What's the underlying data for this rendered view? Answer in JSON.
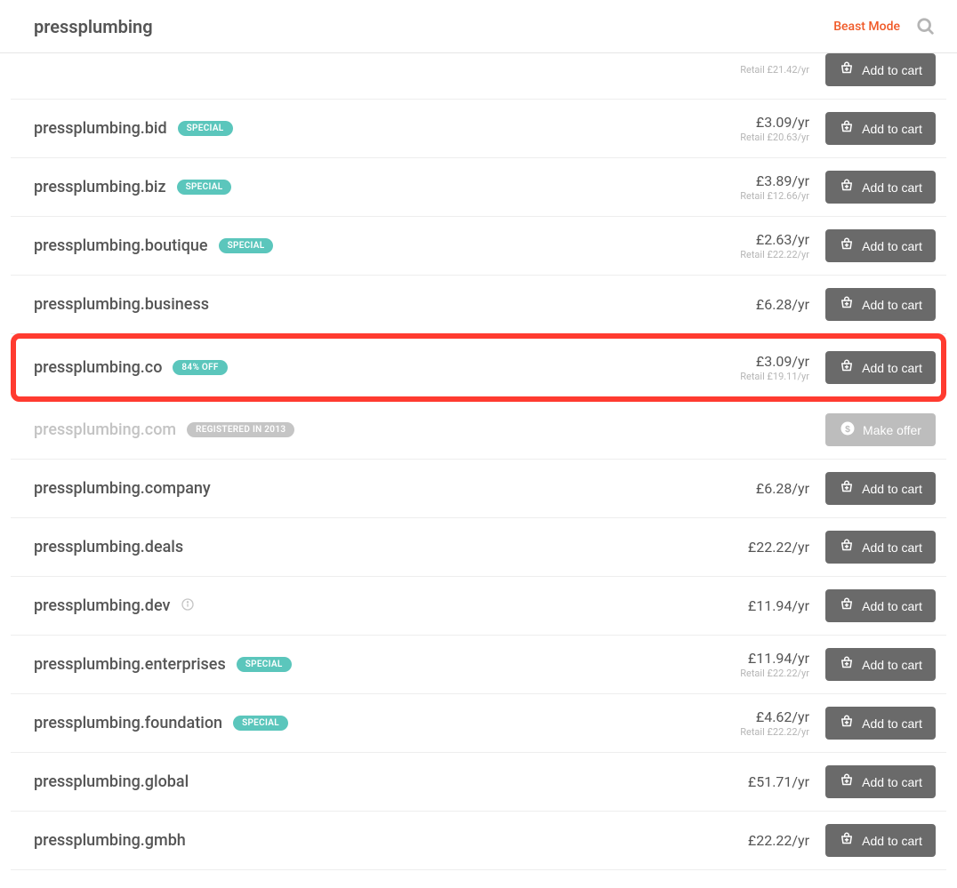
{
  "header": {
    "title": "pressplumbing",
    "beast_mode": "Beast Mode"
  },
  "labels": {
    "add_to_cart": "Add to cart",
    "make_offer": "Make offer"
  },
  "rows": [
    {
      "domain": "",
      "price": "",
      "retail": "Retail £21.42/yr",
      "badge": null,
      "button": "cart",
      "partial": true
    },
    {
      "domain": "pressplumbing.bid",
      "price": "£3.09/yr",
      "retail": "Retail £20.63/yr",
      "badge": "SPECIAL",
      "badge_style": "teal",
      "button": "cart"
    },
    {
      "domain": "pressplumbing.biz",
      "price": "£3.89/yr",
      "retail": "Retail £12.66/yr",
      "badge": "SPECIAL",
      "badge_style": "teal",
      "button": "cart"
    },
    {
      "domain": "pressplumbing.boutique",
      "price": "£2.63/yr",
      "retail": "Retail £22.22/yr",
      "badge": "SPECIAL",
      "badge_style": "teal",
      "button": "cart"
    },
    {
      "domain": "pressplumbing.business",
      "price": "£6.28/yr",
      "retail": "",
      "badge": null,
      "button": "cart"
    },
    {
      "domain": "pressplumbing.co",
      "price": "£3.09/yr",
      "retail": "Retail £19.11/yr",
      "badge": "84% OFF",
      "badge_style": "teal",
      "button": "cart",
      "highlight": true
    },
    {
      "domain": "pressplumbing.com",
      "price": "",
      "retail": "",
      "badge": "REGISTERED IN 2013",
      "badge_style": "grey",
      "button": "offer",
      "muted": true
    },
    {
      "domain": "pressplumbing.company",
      "price": "£6.28/yr",
      "retail": "",
      "badge": null,
      "button": "cart"
    },
    {
      "domain": "pressplumbing.deals",
      "price": "£22.22/yr",
      "retail": "",
      "badge": null,
      "button": "cart"
    },
    {
      "domain": "pressplumbing.dev",
      "price": "£11.94/yr",
      "retail": "",
      "badge": null,
      "info": true,
      "button": "cart"
    },
    {
      "domain": "pressplumbing.enterprises",
      "price": "£11.94/yr",
      "retail": "Retail £22.22/yr",
      "badge": "SPECIAL",
      "badge_style": "teal",
      "button": "cart"
    },
    {
      "domain": "pressplumbing.foundation",
      "price": "£4.62/yr",
      "retail": "Retail £22.22/yr",
      "badge": "SPECIAL",
      "badge_style": "teal",
      "button": "cart"
    },
    {
      "domain": "pressplumbing.global",
      "price": "£51.71/yr",
      "retail": "",
      "badge": null,
      "button": "cart"
    },
    {
      "domain": "pressplumbing.gmbh",
      "price": "£22.22/yr",
      "retail": "",
      "badge": null,
      "button": "cart"
    }
  ]
}
